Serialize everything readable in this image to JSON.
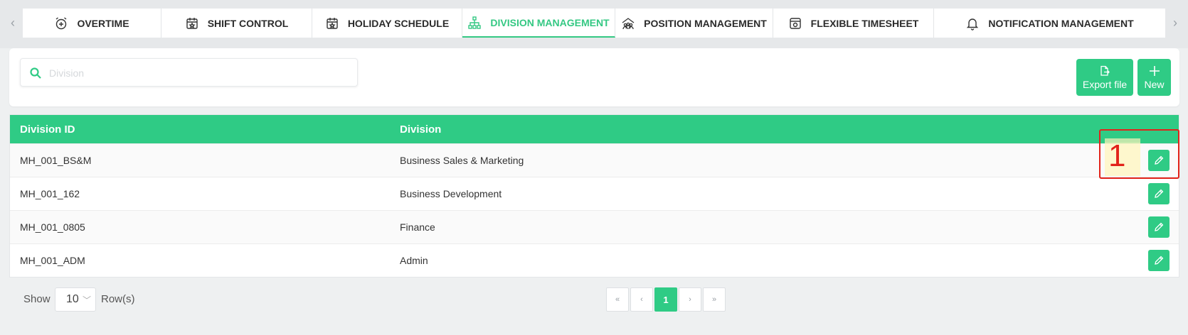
{
  "tabs": [
    {
      "label": "OVERTIME",
      "icon": "alarm-clock-plus-icon",
      "active": false
    },
    {
      "label": "SHIFT CONTROL",
      "icon": "calendar-star-icon",
      "active": false
    },
    {
      "label": "HOLIDAY SCHEDULE",
      "icon": "calendar-star-icon",
      "active": false
    },
    {
      "label": "DIVISION MANAGEMENT",
      "icon": "org-chart-icon",
      "active": true
    },
    {
      "label": "POSITION MANAGEMENT",
      "icon": "team-house-icon",
      "active": false
    },
    {
      "label": "FLEXIBLE TIMESHEET",
      "icon": "calendar-clock-icon",
      "active": false
    },
    {
      "label": "NOTIFICATION MANAGEMENT",
      "icon": "bell-icon",
      "active": false
    }
  ],
  "search": {
    "placeholder": "Division",
    "value": ""
  },
  "toolbar": {
    "export_label": "Export file",
    "new_label": "New"
  },
  "table": {
    "columns": [
      "Division ID",
      "Division"
    ],
    "rows": [
      {
        "id": "MH_001_BS&M",
        "division": "Business Sales & Marketing"
      },
      {
        "id": "MH_001_162",
        "division": "Business Development"
      },
      {
        "id": "MH_001_0805",
        "division": "Finance"
      },
      {
        "id": "MH_001_ADM",
        "division": "Admin"
      }
    ]
  },
  "annotation": {
    "label": "1"
  },
  "footer": {
    "show_label": "Show",
    "page_size": "10",
    "rows_label": "Row(s)",
    "pagination": {
      "first": "«",
      "prev": "‹",
      "current": "1",
      "next": "›",
      "last": "»"
    }
  },
  "colors": {
    "accent": "#2fcb85",
    "annotation": "#e2231a",
    "background": "#eef0f1"
  }
}
